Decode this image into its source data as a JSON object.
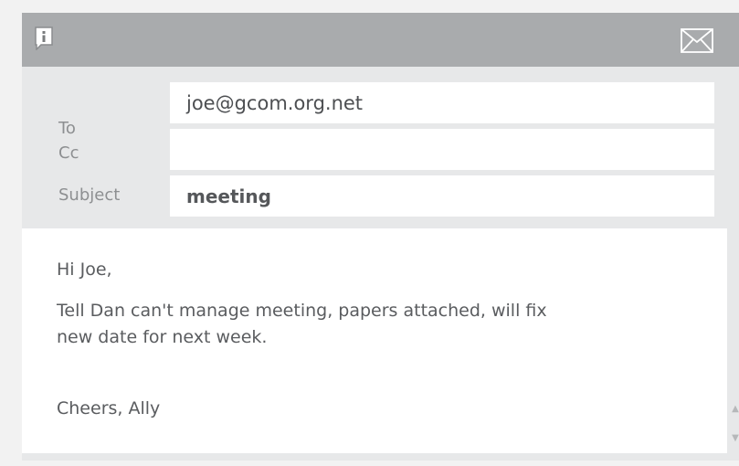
{
  "email": {
    "to_label": "To",
    "to_value": "joe@gcom.org.net",
    "cc_label": "Cc",
    "cc_value": "",
    "subject_label": "Subject",
    "subject_value": "meeting",
    "greeting": "Hi Joe,",
    "message_line1": "Tell Dan can't manage meeting, papers attached, will fix",
    "message_line2": "new date for next week.",
    "signoff": "Cheers, Ally"
  },
  "icons": {
    "info": "info-icon",
    "mail": "envelope-icon",
    "scroll_up": "scroll-up-arrow-icon",
    "scroll_down": "scroll-down-arrow-icon"
  },
  "colors": {
    "titlebar": "#a9abad",
    "background": "#e7e8e9",
    "field": "#ffffff"
  }
}
